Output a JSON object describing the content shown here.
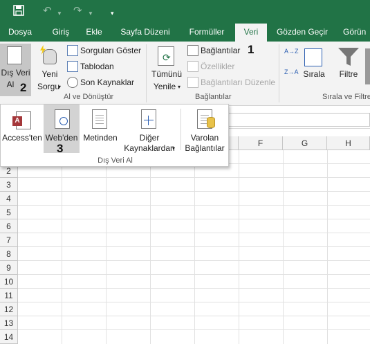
{
  "titlebar": {
    "icons": [
      "save-icon",
      "undo-icon",
      "redo-icon",
      "customize-icon"
    ]
  },
  "tabs": [
    {
      "label": "Dosya"
    },
    {
      "label": "Giriş"
    },
    {
      "label": "Ekle"
    },
    {
      "label": "Sayfa Düzeni"
    },
    {
      "label": "Formüller"
    },
    {
      "label": "Veri",
      "active": true
    },
    {
      "label": "Gözden Geçir"
    },
    {
      "label": "Görün"
    }
  ],
  "ribbon": {
    "dis_veri_al": {
      "line1": "Dış Veri",
      "line2": "Al"
    },
    "yeni_sorgu": {
      "line1": "Yeni",
      "line2": "Sorgu"
    },
    "sorgulari_goster": "Sorguları Göster",
    "tablodan": "Tablodan",
    "son_kaynaklar": "Son Kaynaklar",
    "group_al_donustur": "Al ve Dönüştür",
    "tumunu_yenile": {
      "line1": "Tümünü",
      "line2": "Yenile"
    },
    "baglantilar": "Bağlantılar",
    "ozellikler": "Özellikler",
    "baglantilari_duzenle": "Bağlantıları Düzenle",
    "group_baglantilar": "Bağlantılar",
    "sirala": "Sırala",
    "filtre": "Filtre",
    "group_sirala_filtre": "Sırala ve Filtre",
    "sort_az": "A→Z",
    "sort_za": "Z→A"
  },
  "steps": {
    "one": "1",
    "two": "2",
    "three": "3"
  },
  "dropdown": {
    "items": [
      {
        "line1": "Access'ten"
      },
      {
        "line1": "Web'den"
      },
      {
        "line1": "Metinden"
      },
      {
        "line1": "Diğer",
        "line2": "Kaynaklardan"
      },
      {
        "line1": "Varolan",
        "line2": "Bağlantılar"
      }
    ],
    "group_label": "Dış Veri Al"
  },
  "grid": {
    "columns": [
      "F",
      "G",
      "H"
    ],
    "rows": [
      "2",
      "3",
      "4",
      "5",
      "6",
      "7",
      "8",
      "9",
      "10",
      "11",
      "12",
      "13",
      "14"
    ]
  }
}
